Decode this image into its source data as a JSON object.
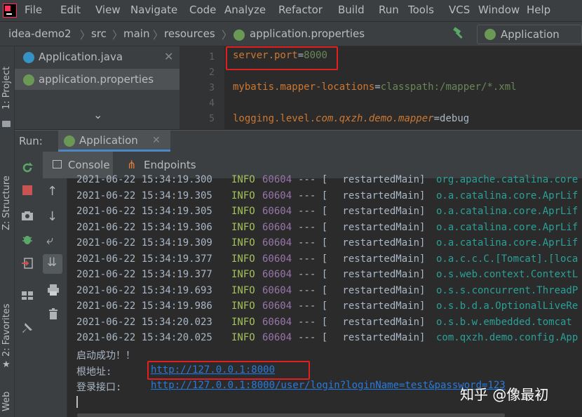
{
  "menu": [
    "File",
    "Edit",
    "View",
    "Navigate",
    "Code",
    "Analyze",
    "Refactor",
    "Build",
    "Run",
    "Tools",
    "VCS",
    "Window",
    "Help"
  ],
  "breadcrumb": [
    "idea-demo2",
    "src",
    "main",
    "resources",
    "application.properties"
  ],
  "run_config": "Application",
  "side_tabs": {
    "project": "1: Project",
    "structure": "Z: Structure",
    "favorites": "2: Favorites",
    "web": "Web"
  },
  "editor_tabs": [
    {
      "label": "Application.java"
    },
    {
      "label": "application.properties"
    }
  ],
  "line_numbers": [
    "1",
    "2",
    "3",
    "4",
    "5"
  ],
  "code": {
    "l1_key": "server.port",
    "l1_val": "8000",
    "l3_key": "mybatis.mapper-locations",
    "l3_val": "classpath:/mapper/*.xml",
    "l5_prefix": "logging.level.",
    "l5_pkg": "com.qxzh.demo.mapper",
    "l5_val": "debug",
    "eq": "="
  },
  "run_panel": {
    "label": "Run:",
    "tab": "Application",
    "sub_tabs": [
      "Console",
      "Endpoints"
    ]
  },
  "log_lines": [
    {
      "ts": "2021-06-22 15:34:19.300",
      "lvl": "INFO",
      "pid": "60604",
      "sep": "--- [",
      "thread": " restartedMain]",
      "logger": "org.apache.catalina.core"
    },
    {
      "ts": "2021-06-22 15:34:19.305",
      "lvl": "INFO",
      "pid": "60604",
      "sep": "--- [",
      "thread": " restartedMain]",
      "logger": "o.a.catalina.core.AprLif"
    },
    {
      "ts": "2021-06-22 15:34:19.305",
      "lvl": "INFO",
      "pid": "60604",
      "sep": "--- [",
      "thread": " restartedMain]",
      "logger": "o.a.catalina.core.AprLif"
    },
    {
      "ts": "2021-06-22 15:34:19.306",
      "lvl": "INFO",
      "pid": "60604",
      "sep": "--- [",
      "thread": " restartedMain]",
      "logger": "o.a.catalina.core.AprLif"
    },
    {
      "ts": "2021-06-22 15:34:19.309",
      "lvl": "INFO",
      "pid": "60604",
      "sep": "--- [",
      "thread": " restartedMain]",
      "logger": "o.a.catalina.core.AprLif"
    },
    {
      "ts": "2021-06-22 15:34:19.377",
      "lvl": "INFO",
      "pid": "60604",
      "sep": "--- [",
      "thread": " restartedMain]",
      "logger": "o.a.c.c.C.[Tomcat].[loca"
    },
    {
      "ts": "2021-06-22 15:34:19.377",
      "lvl": "INFO",
      "pid": "60604",
      "sep": "--- [",
      "thread": " restartedMain]",
      "logger": "o.s.web.context.ContextL"
    },
    {
      "ts": "2021-06-22 15:34:19.693",
      "lvl": "INFO",
      "pid": "60604",
      "sep": "--- [",
      "thread": " restartedMain]",
      "logger": "o.s.s.concurrent.ThreadP"
    },
    {
      "ts": "2021-06-22 15:34:19.986",
      "lvl": "INFO",
      "pid": "60604",
      "sep": "--- [",
      "thread": " restartedMain]",
      "logger": "o.s.b.d.a.OptionalLiveRe"
    },
    {
      "ts": "2021-06-22 15:34:20.023",
      "lvl": "INFO",
      "pid": "60604",
      "sep": "--- [",
      "thread": " restartedMain]",
      "logger": "o.s.b.w.embedded.tomcat"
    },
    {
      "ts": "2021-06-22 15:34:20.025",
      "lvl": "INFO",
      "pid": "60604",
      "sep": "--- [",
      "thread": " restartedMain]",
      "logger": "com.qxzh.demo.config.App"
    }
  ],
  "startup": {
    "success": "启动成功！！",
    "root_label": "根地址:",
    "root_url": "http://127.0.0.1:8000",
    "login_label": "登录接口:",
    "login_url": "http://127.0.0.1:8000/user/login?loginName=test&password=123"
  },
  "watermark": "知乎 @像最初",
  "colors": {
    "highlight_box": "#e02020",
    "spring_green": "#6a9955",
    "link": "#287bde"
  }
}
